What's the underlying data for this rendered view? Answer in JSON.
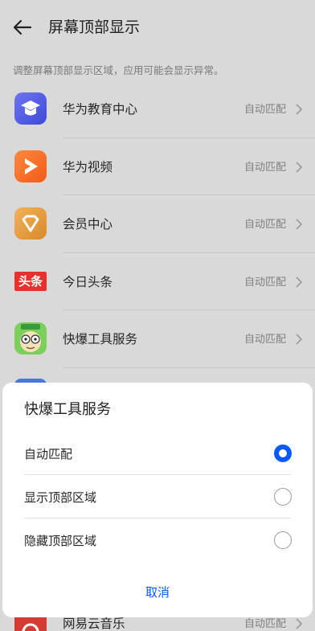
{
  "header": {
    "title": "屏幕顶部显示"
  },
  "hint": "调整屏幕顶部显示区域，应用可能会显示异常。",
  "apps": [
    {
      "name": "华为教育中心",
      "value": "自动匹配",
      "icon": "graduation-cap-icon"
    },
    {
      "name": "华为视频",
      "value": "自动匹配",
      "icon": "play-icon"
    },
    {
      "name": "会员中心",
      "value": "自动匹配",
      "icon": "diamond-icon"
    },
    {
      "name": "今日头条",
      "value": "自动匹配",
      "icon": "toutiao-logo-icon",
      "icon_text": "头条"
    },
    {
      "name": "快爆工具服务",
      "value": "自动匹配",
      "icon": "cartoon-face-icon"
    }
  ],
  "peek_app": {
    "name": "网易云音乐",
    "value": "自动匹配",
    "icon": "netease-music-icon"
  },
  "dialog": {
    "title": "快爆工具服务",
    "options": [
      {
        "label": "自动匹配",
        "selected": true
      },
      {
        "label": "显示顶部区域",
        "selected": false
      },
      {
        "label": "隐藏顶部区域",
        "selected": false
      }
    ],
    "cancel": "取消"
  },
  "colors": {
    "accent": "#0a59f7",
    "dim_background": "#d9d9d9"
  }
}
